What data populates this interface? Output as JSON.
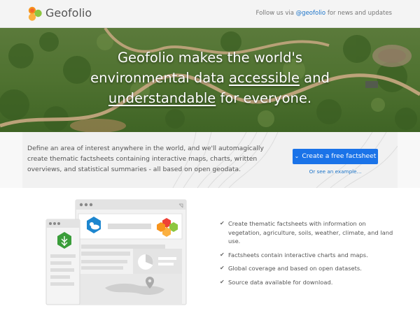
{
  "header": {
    "brand": "Geofolio",
    "follow_prefix": "Follow us via",
    "follow_handle": "@geofolio",
    "follow_suffix": "for news and updates"
  },
  "hero": {
    "line1": "Geofolio makes the world's",
    "line2_a": "environmental data",
    "line2_u": "accessible",
    "line2_b": "and",
    "line3_u": "understandable",
    "line3_b": "for everyone."
  },
  "intro": {
    "description": "Define an area of interest anywhere in the world, and we'll automagically create thematic factsheets containing interactive maps, charts, written overviews, and statistical summaries - all based on open geodata.",
    "cta_label": "Create a free factsheet",
    "example_link": "Or see an example..."
  },
  "features": [
    "Create thematic factsheets with information on vegetation, agriculture, soils, weather, climate, and land use.",
    "Factsheets contain interactive charts and maps.",
    "Global coverage and based on open datasets.",
    "Source data available for download."
  ],
  "colors": {
    "accent": "#1a73e8",
    "logo_orange": "#f7941d",
    "logo_red": "#ef4136",
    "logo_yellow": "#fbb040",
    "logo_green": "#8dc63f"
  }
}
